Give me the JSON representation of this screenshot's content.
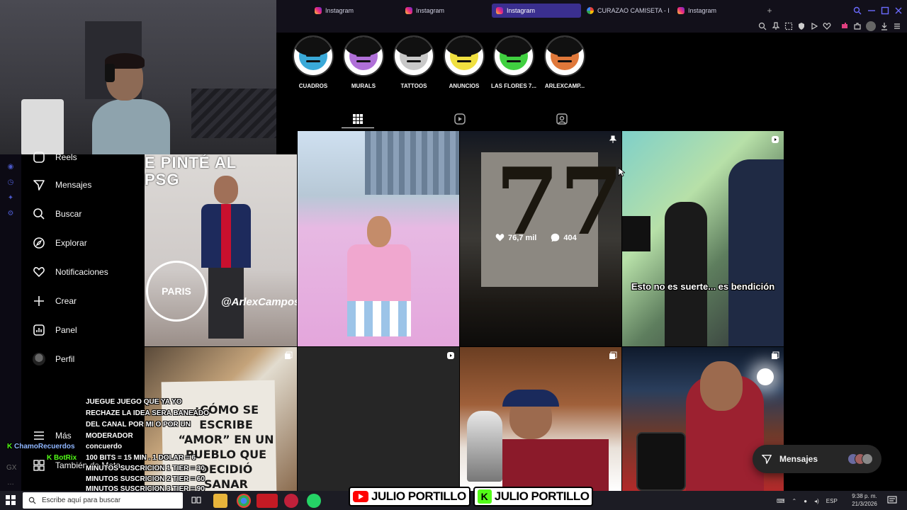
{
  "browser": {
    "tabs": [
      {
        "label": "Instagram",
        "favicon": "instagram-icon",
        "active": false
      },
      {
        "label": "Instagram",
        "favicon": "instagram-icon",
        "active": false
      },
      {
        "label": "Instagram",
        "favicon": "instagram-icon",
        "active": true
      },
      {
        "label": "CURAZAO CAMISETA - Bu",
        "favicon": "google-icon",
        "active": false
      },
      {
        "label": "Instagram",
        "favicon": "instagram-icon",
        "active": false
      }
    ],
    "new_tab": "+"
  },
  "highlights": [
    {
      "label": "CUADROS",
      "color": "#3aa9d8"
    },
    {
      "label": "MURALS",
      "color": "#b070d8"
    },
    {
      "label": "TATTOOS",
      "color": "#c8c8c8"
    },
    {
      "label": "ANUNCIOS",
      "color": "#f0e040"
    },
    {
      "label": "LAS FLORES 7...",
      "color": "#40d040"
    },
    {
      "label": "ARLEXCAMP...",
      "color": "#e0783a"
    }
  ],
  "nav": {
    "items": [
      {
        "label": "Reels",
        "icon": "reels-icon"
      },
      {
        "label": "Mensajes",
        "icon": "messages-icon"
      },
      {
        "label": "Buscar",
        "icon": "search-icon"
      },
      {
        "label": "Explorar",
        "icon": "explore-icon"
      },
      {
        "label": "Notificaciones",
        "icon": "heart-icon"
      },
      {
        "label": "Crear",
        "icon": "plus-icon"
      },
      {
        "label": "Panel",
        "icon": "dashboard-icon"
      },
      {
        "label": "Perfil",
        "icon": "avatar-icon"
      }
    ],
    "more": "Más",
    "also": "También de Meta"
  },
  "posts": {
    "p1": {
      "title_line1": "E PINTÉ AL",
      "title_line2": "PSG",
      "logo": "PARIS",
      "signature": "@ArlexCampos"
    },
    "p3": {
      "number": "77",
      "likes": "76,7 mil",
      "comments": "404"
    },
    "p4": {
      "caption": "Esto no es suerte... es bendición"
    },
    "p5": {
      "text": "¿CÓMO SE ESCRIBE “AMOR” EN UN PUEBLO QUE DECIDIÓ SANAR"
    }
  },
  "chat": {
    "lines": [
      "JUEGUE JUEGO QUE YA YO",
      "RECHAZE LA IDEA SERA BANEADO",
      "DEL CANAL POR MI O POR UN",
      "MODERADOR"
    ],
    "user1": "ChamoRecuerdos",
    "msg1": "concuerdo",
    "user2": "BotRix",
    "bot_lines": [
      "100 BITS = 15 MIN . 1 DOLAR = 6",
      "MINUTOS SUSCRICION 1 TIER = 30",
      "MINUTOS SUSCRICION 2 TIER = 60",
      "MINUTOS SUSCRICION 3 TIER = 90"
    ]
  },
  "messages_pill": {
    "label": "Mensajes"
  },
  "taskbar": {
    "search_placeholder": "Escribe aquí para buscar",
    "lang": "ESP",
    "time": "9:38 p. m.",
    "date": "21/3/2026"
  },
  "banner": {
    "name1": "JULIO PORTILLO",
    "name2": "JULIO PORTILLO"
  }
}
